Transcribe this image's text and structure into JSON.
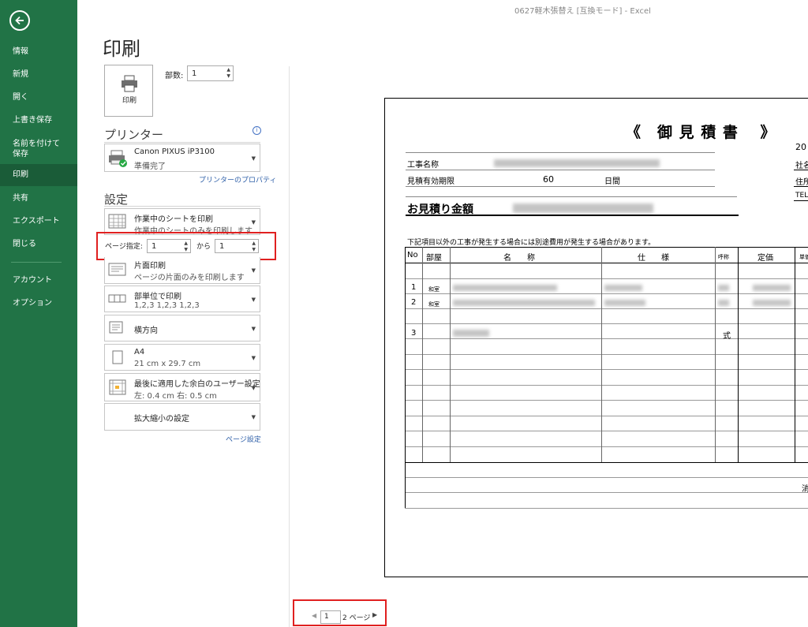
{
  "window_title": "0627軽木張替え [互換モード] - Excel",
  "page_heading": "印刷",
  "sidebar": {
    "items": [
      {
        "label": "情報"
      },
      {
        "label": "新規"
      },
      {
        "label": "開く"
      },
      {
        "label": "上書き保存"
      },
      {
        "label": "名前を付けて"
      },
      {
        "label": "保存"
      },
      {
        "label": "印刷"
      },
      {
        "label": "共有"
      },
      {
        "label": "エクスポート"
      },
      {
        "label": "閉じる"
      },
      {
        "label": "アカウント"
      },
      {
        "label": "オプション"
      }
    ]
  },
  "print_button": {
    "label": "印刷"
  },
  "copies": {
    "label": "部数:",
    "value": "1"
  },
  "printer": {
    "heading": "プリンター",
    "name": "Canon PIXUS iP3100",
    "status": "準備完了",
    "properties_link": "プリンターのプロパティ"
  },
  "settings": {
    "heading": "設定",
    "scope": {
      "title": "作業中のシートを印刷",
      "desc": "作業中のシートのみを印刷します"
    },
    "pages": {
      "label": "ページ指定:",
      "from": "1",
      "to_label": "から",
      "to": "1"
    },
    "sides": {
      "title": "片面印刷",
      "desc": "ページの片面のみを印刷します"
    },
    "collate": {
      "title": "部単位で印刷",
      "desc": "1,2,3    1,2,3    1,2,3"
    },
    "orientation": {
      "title": "横方向"
    },
    "paper": {
      "title": "A4",
      "desc": "21 cm x 29.7 cm"
    },
    "margins": {
      "title": "最後に適用した余白のユーザー設定",
      "desc": "左:  0.4 cm     右:  0.5 cm"
    },
    "scaling": {
      "title": "拡大縮小の設定"
    },
    "page_setup_link": "ページ設定"
  },
  "preview": {
    "doc_title": "《　御 見 積 書　 》",
    "year_partial": "20",
    "company_partial": "社名",
    "address_partial": "住所",
    "tel_partial": "TEL",
    "project_label": "工事名称",
    "validity_label": "見積有効期限",
    "validity_value": "60",
    "validity_unit": "日間",
    "amount_label": "お見積り金額",
    "note": "下記項目以外の工事が発生する場合には別途費用が発生する場合があります。",
    "columns": [
      "No",
      "部屋",
      "名　　称",
      "仕　　様",
      "呼称",
      "定価",
      "単価"
    ],
    "rows": [
      {
        "no": "1",
        "room": "和室"
      },
      {
        "no": "2",
        "room": "和室"
      },
      {
        "no": "3",
        "unit": "式"
      }
    ],
    "footer_partial": "消"
  },
  "page_nav": {
    "current": "1",
    "total": "2 ページ"
  }
}
